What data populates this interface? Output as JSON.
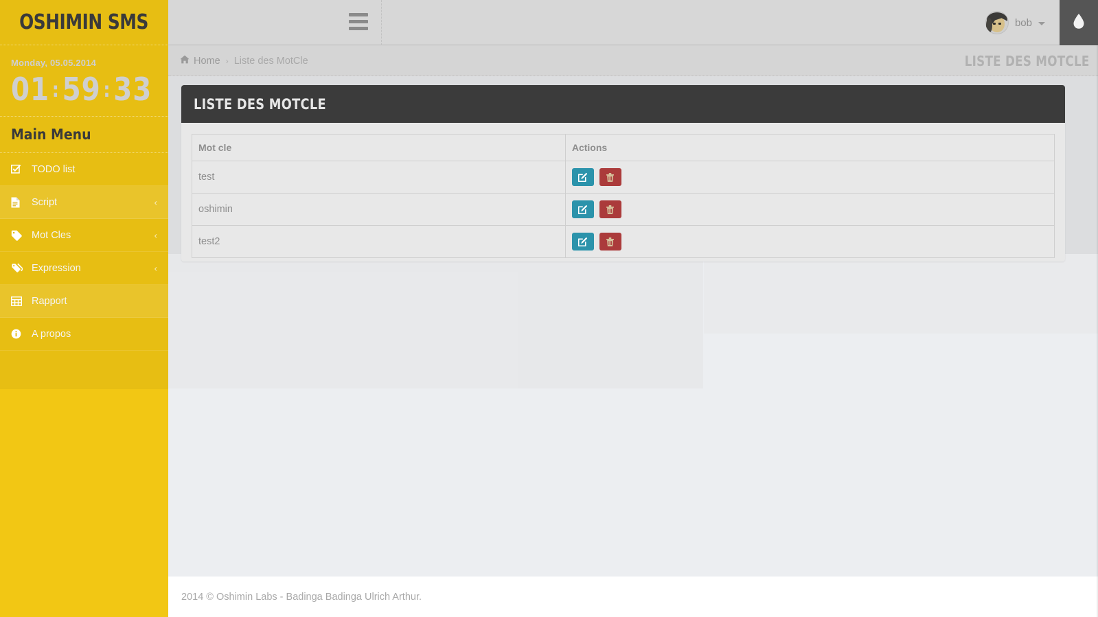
{
  "sidebar": {
    "brand": "OSHIMIN SMS",
    "clock": {
      "date": "Monday, 05.05.2014",
      "hours": "01",
      "minutes": "59",
      "seconds": "33",
      "separator": ":"
    },
    "menu_title": "Main Menu",
    "items": [
      {
        "label": "TODO list",
        "icon": "check-square-icon",
        "caret": "",
        "highlighted": false
      },
      {
        "label": "Script",
        "icon": "file-text-icon",
        "caret": "‹",
        "highlighted": true
      },
      {
        "label": "Mot Cles",
        "icon": "tag-icon",
        "caret": "‹",
        "highlighted": false
      },
      {
        "label": "Expression",
        "icon": "tags-icon",
        "caret": "‹",
        "highlighted": false
      },
      {
        "label": "Rapport",
        "icon": "table-icon",
        "caret": "",
        "highlighted": true
      },
      {
        "label": "A propos",
        "icon": "info-circle-icon",
        "caret": "",
        "highlighted": false
      }
    ]
  },
  "header": {
    "menu_toggle": "hamburger-icon",
    "username": "bob",
    "user_caret": "chevron-down-icon",
    "theme_icon": "tint-droplet-icon"
  },
  "breadcrumb": {
    "home_icon": "home-icon",
    "home": "Home",
    "separator": "›",
    "current": "Liste des MotCle"
  },
  "page": {
    "title": "LISTE DES MOTCLE",
    "panel_title": "LISTE DES MOTCLE"
  },
  "table": {
    "columns": [
      "Mot cle",
      "Actions"
    ],
    "rows": [
      {
        "mot_cle": "test",
        "edit_label": "edit-icon",
        "delete_label": "trash-icon"
      },
      {
        "mot_cle": "oshimin",
        "edit_label": "edit-icon",
        "delete_label": "trash-icon"
      },
      {
        "mot_cle": "test2",
        "edit_label": "edit-icon",
        "delete_label": "trash-icon"
      }
    ]
  },
  "footer": {
    "text": "2014 © Oshimin Labs - Badinga Badinga Ulrich Arthur."
  },
  "colors": {
    "sidebar_yellow": "#f2c714",
    "panel_header_dark": "#3b3b3b",
    "edit_teal": "#2b93ab",
    "delete_red": "#ab3b3b",
    "content_bg": "#eceef1"
  }
}
